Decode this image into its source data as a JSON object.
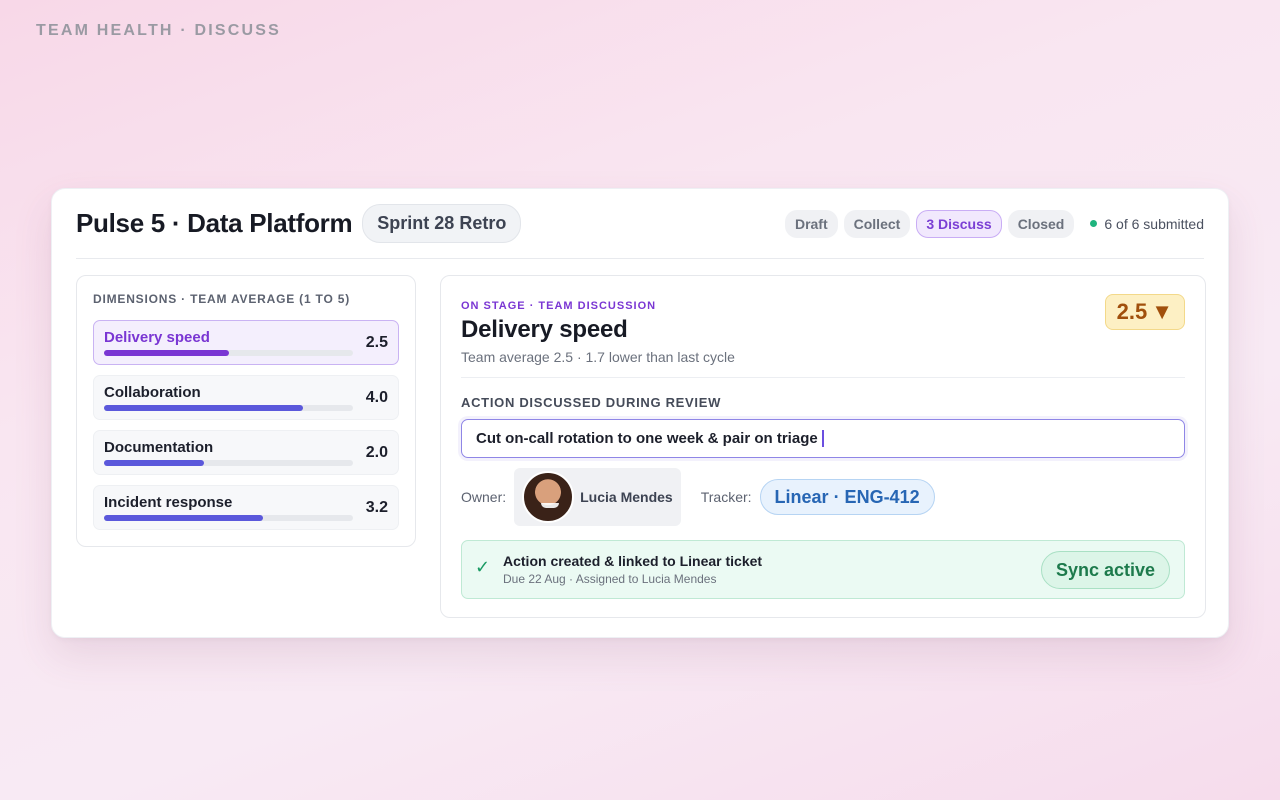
{
  "brand": "TEAM HEALTH · DISCUSS",
  "header": {
    "title": "Pulse 5 · Data Platform",
    "sprint": "Sprint 28 Retro",
    "stages": [
      "Draft",
      "Collect",
      "3 Discuss",
      "Closed"
    ],
    "active_stage": "3 Discuss",
    "submitted": "6 of 6 submitted"
  },
  "dimensions": {
    "label": "DIMENSIONS · TEAM AVERAGE (1 TO 5)",
    "scale_max": 5,
    "items": [
      {
        "name": "Delivery speed",
        "score": "2.5",
        "value": 2.5,
        "selected": true
      },
      {
        "name": "Collaboration",
        "score": "4.0",
        "value": 4.0,
        "selected": false
      },
      {
        "name": "Documentation",
        "score": "2.0",
        "value": 2.0,
        "selected": false
      },
      {
        "name": "Incident response",
        "score": "3.2",
        "value": 3.2,
        "selected": false
      }
    ]
  },
  "discussion": {
    "eyebrow": "ON STAGE · TEAM DISCUSSION",
    "topic": "Delivery speed",
    "subtitle": "Team average 2.5 · 1.7 lower than last cycle",
    "score": "2.5",
    "trend_icon": "triangle-down-icon",
    "action_label": "ACTION DISCUSSED DURING REVIEW",
    "action_value": "Cut on-call rotation to one week & pair on triage",
    "owner_label": "Owner:",
    "owner_name": "Lucia Mendes",
    "tracker_label": "Tracker:",
    "tracker_value": "Linear · ENG-412",
    "sync": {
      "title": "Action created & linked to Linear ticket",
      "subtitle": "Due 22 Aug · Assigned to Lucia Mendes",
      "status": "Sync active"
    }
  },
  "colors": {
    "accent": "#7a36d3",
    "bar": "#5b58db",
    "success": "#1d7a4c",
    "warning": "#a1500c",
    "link": "#2766b4"
  }
}
